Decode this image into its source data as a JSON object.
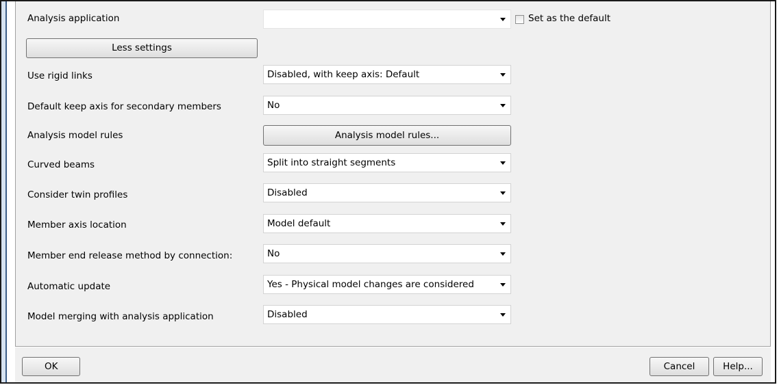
{
  "form": {
    "rows": [
      {
        "label": "Analysis application",
        "value": ""
      },
      {
        "label": "Use rigid links",
        "value": "Disabled, with keep axis: Default"
      },
      {
        "label": "Default keep axis for secondary members",
        "value": "No"
      },
      {
        "label": "Analysis model rules",
        "button": "Analysis model rules..."
      },
      {
        "label": "Curved beams",
        "value": "Split into straight segments"
      },
      {
        "label": "Consider twin profiles",
        "value": "Disabled"
      },
      {
        "label": "Member axis location",
        "value": "Model default"
      },
      {
        "label": "Member end release method by connection:",
        "value": "No"
      },
      {
        "label": "Automatic update",
        "value": "Yes - Physical model changes are considered"
      },
      {
        "label": "Model merging with analysis application",
        "value": "Disabled"
      }
    ],
    "set_default_label": "Set as the default",
    "set_default_checked": false,
    "less_settings_label": "Less settings"
  },
  "footer": {
    "ok_label": "OK",
    "cancel_label": "Cancel",
    "help_label": "Help..."
  }
}
